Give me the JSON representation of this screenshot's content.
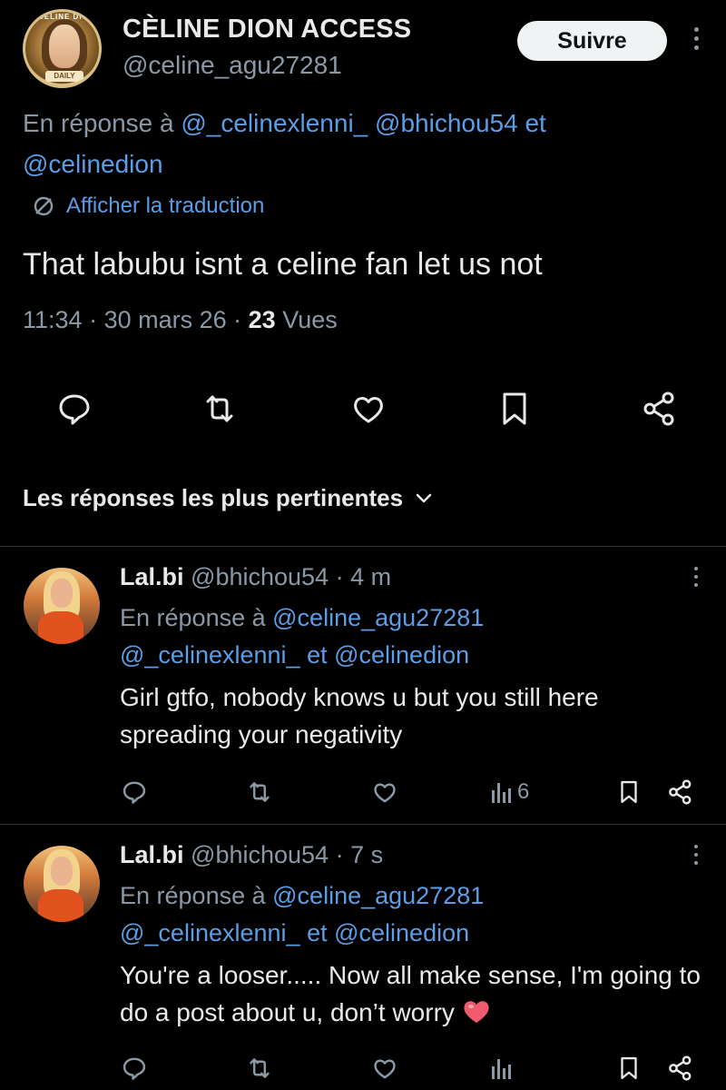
{
  "post": {
    "display_name": "CÈLINE DION ACCESS",
    "handle": "@celine_agu27281",
    "avatar_text_top": "CÈLINE DION",
    "avatar_text_bottom": "DAILY",
    "follow_label": "Suivre",
    "reply_prefix": "En réponse à",
    "reply_mention_1": "@_celinexlenni_",
    "reply_mention_2": "@bhichou54",
    "reply_and": "et",
    "reply_mention_3": "@celinedion",
    "translate_label": "Afficher la traduction",
    "text": "That labubu isnt a celine fan let us not",
    "time": "11:34",
    "date": "30 mars 26",
    "views_count": "23",
    "views_label": "Vues"
  },
  "replies_section": {
    "title": "Les réponses les plus pertinentes"
  },
  "replies": [
    {
      "name": "Lal.bi",
      "handle": "@bhichou54",
      "age": "4 m",
      "reply_prefix": "En réponse à",
      "mention_1": "@celine_agu27281",
      "mention_2": "@_celinexlenni_",
      "reply_and": "et",
      "mention_3": "@celinedion",
      "text": "Girl gtfo, nobody knows u but you still here spreading your negativity",
      "views": "6"
    },
    {
      "name": "Lal.bi",
      "handle": "@bhichou54",
      "age": "7 s",
      "reply_prefix": "En réponse à",
      "mention_1": "@celine_agu27281",
      "mention_2": "@_celinexlenni_",
      "reply_and": "et",
      "mention_3": "@celinedion",
      "text": "You're a looser..... Now all make sense, I'm going to do a post about u, don’t worry",
      "views": ""
    }
  ],
  "colors": {
    "background": "#000000",
    "text": "#e7e9ea",
    "secondary": "#8b98a5",
    "link": "#5b9de6",
    "divider": "#2f3336",
    "heart_emoji": "#f05a6e"
  }
}
